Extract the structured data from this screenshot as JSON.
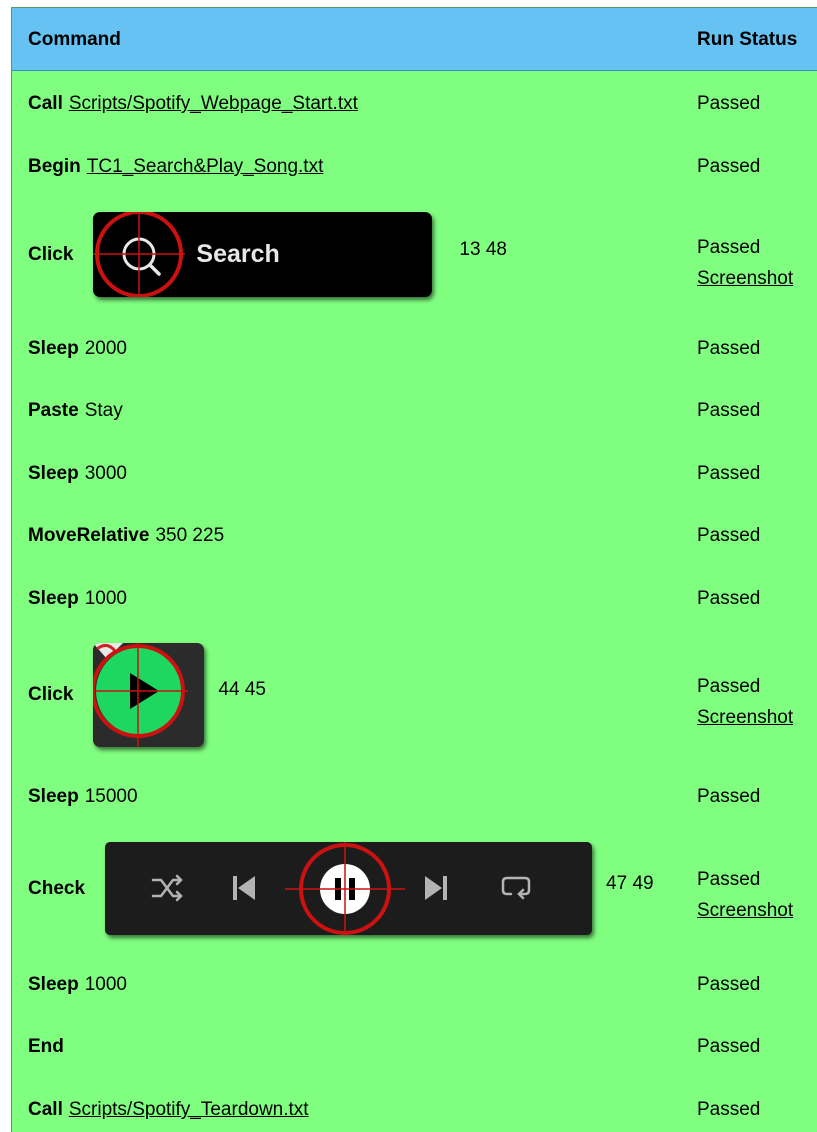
{
  "header": {
    "command": "Command",
    "run_status": "Run Status"
  },
  "rows": [
    {
      "keyword": "Call",
      "arg": "Scripts/Spotify_Webpage_Start.txt",
      "status": "Passed"
    },
    {
      "keyword": "Begin",
      "arg": "TC1_Search&Play_Song.txt",
      "status": "Passed"
    },
    {
      "keyword": "Click",
      "thumb_label": "Search",
      "coords": "13 48",
      "status": "Passed",
      "screenshot": "Screenshot"
    },
    {
      "keyword": "Sleep",
      "arg": "2000",
      "status": "Passed"
    },
    {
      "keyword": "Paste",
      "arg": "Stay",
      "status": "Passed"
    },
    {
      "keyword": "Sleep",
      "arg": "3000",
      "status": "Passed"
    },
    {
      "keyword": "MoveRelative",
      "arg": "350 225",
      "status": "Passed"
    },
    {
      "keyword": "Sleep",
      "arg": "1000",
      "status": "Passed"
    },
    {
      "keyword": "Click",
      "coords": "44 45",
      "status": "Passed",
      "screenshot": "Screenshot"
    },
    {
      "keyword": "Sleep",
      "arg": "15000",
      "status": "Passed"
    },
    {
      "keyword": "Check",
      "coords": "47 49",
      "status": "Passed",
      "screenshot": "Screenshot"
    },
    {
      "keyword": "Sleep",
      "arg": "1000",
      "status": "Passed"
    },
    {
      "keyword": "End",
      "status": "Passed"
    },
    {
      "keyword": "Call",
      "arg": "Scripts/Spotify_Teardown.txt",
      "status": "Passed"
    }
  ],
  "colors": {
    "row_background": "#80fe80",
    "header_background": "#66c2f2",
    "target_marker": "#cc1111",
    "spotify_green": "#1ed760"
  },
  "icons": [
    "search-icon",
    "play-icon",
    "shuffle-icon",
    "previous-icon",
    "pause-icon",
    "next-icon",
    "repeat-icon",
    "crosshair-marker"
  ]
}
